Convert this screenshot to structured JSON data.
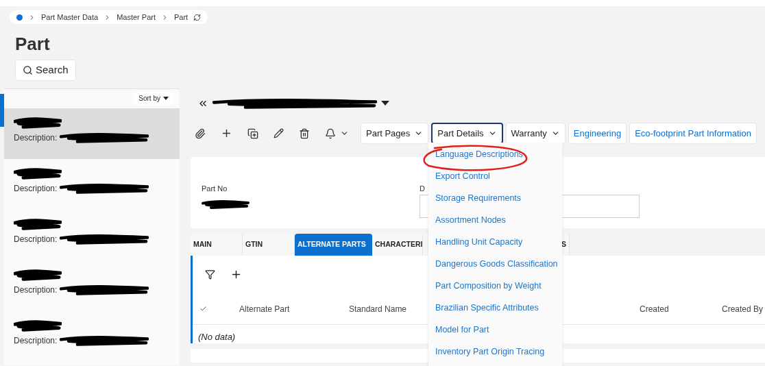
{
  "breadcrumb": [
    "Part Master Data",
    "Master Part",
    "Part"
  ],
  "page_title": "Part",
  "search": {
    "label": "Search"
  },
  "list": {
    "sort_label": "Sort by",
    "items": [
      {
        "label": "Description:",
        "selected": true
      },
      {
        "label": "Description:",
        "selected": false
      },
      {
        "label": "Description:",
        "selected": false
      },
      {
        "label": "Description:",
        "selected": false
      },
      {
        "label": "Description:",
        "selected": false
      }
    ]
  },
  "toolbar_menus": [
    {
      "kind": "dropdown",
      "label": "Part Pages",
      "selected": false
    },
    {
      "kind": "dropdown",
      "label": "Part Details",
      "selected": true
    },
    {
      "kind": "dropdown",
      "label": "Warranty",
      "selected": false
    },
    {
      "kind": "link",
      "label": "Engineering",
      "selected": false
    },
    {
      "kind": "link",
      "label": "Eco-footprint Part Information",
      "selected": false
    }
  ],
  "dropdown_menu": [
    "Language Descriptions",
    "Export Control",
    "Storage Requirements",
    "Assortment Nodes",
    "Handling Unit Capacity",
    "Dangerous Goods Classification",
    "Part Composition by Weight",
    "Brazilian Specific Attributes",
    "Model for Part",
    "Inventory Part Origin Tracing"
  ],
  "header_fields": [
    {
      "label": "Part No"
    },
    {
      "label": "D"
    }
  ],
  "tabs": [
    {
      "label": "MAIN",
      "selected": false
    },
    {
      "label": "GTIN",
      "selected": false
    },
    {
      "label": "ALTERNATE PARTS",
      "selected": true
    },
    {
      "label": "CHARACTERI",
      "selected": false
    },
    {
      "label": "S",
      "selected": false
    }
  ],
  "table": {
    "columns": [
      "Alternate Part",
      "Standard Name",
      "Created",
      "Created By"
    ],
    "empty_text": "(No data)"
  }
}
